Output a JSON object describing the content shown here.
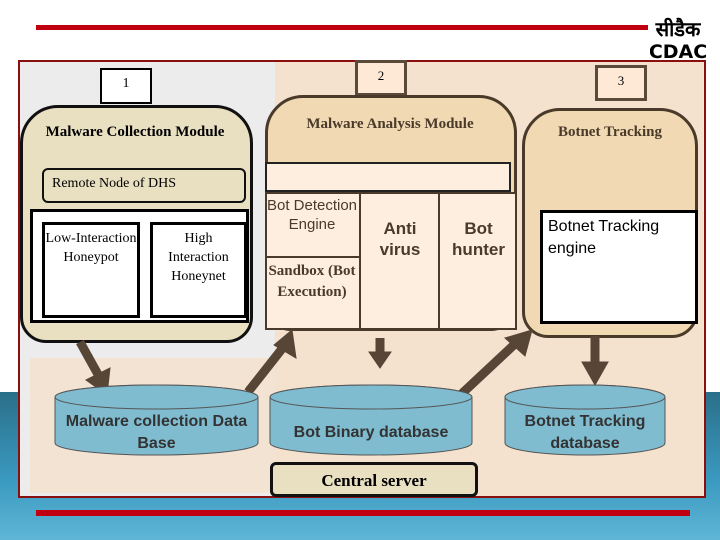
{
  "logo": {
    "text": "सीडैक CDAC"
  },
  "numbers": [
    "1",
    "2",
    "3"
  ],
  "module1": {
    "title": "Malware Collection Module",
    "remote": "Remote Node of DHS",
    "low": "Low-Interaction Honeypot",
    "high": "High Interaction Honeynet"
  },
  "module2": {
    "title": "Malware Analysis Module",
    "bot_detection": "Bot Detection Engine",
    "sandbox": "Sandbox (Bot Execution)",
    "antivirus": "Anti virus",
    "bothunter": "Bot hunter"
  },
  "module3": {
    "title": "Botnet Tracking",
    "engine": "Botnet Tracking engine"
  },
  "databases": [
    "Malware collection Data Base",
    "Bot Binary database",
    "Botnet Tracking database"
  ],
  "central": "Central server",
  "colors": {
    "accent_red": "#c00010",
    "module1_fill": "#e9e0c2",
    "module2_fill": "#f1d9b3",
    "db_fill": "#7fbcd0",
    "arrow": "#574535"
  }
}
